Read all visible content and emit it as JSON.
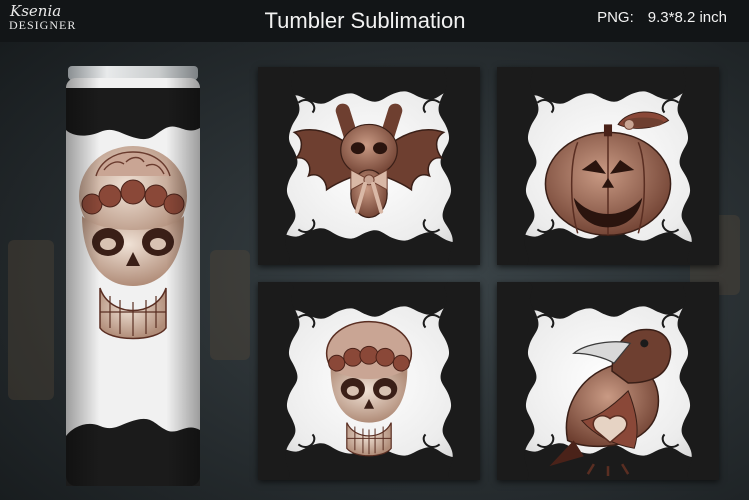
{
  "brand": {
    "script_text": "Ksenia",
    "caps_text": "DESIGNER"
  },
  "header": {
    "title": "Tumbler Sublimation",
    "format_label": "PNG:",
    "format_size": "9.3*8.2 inch"
  },
  "palette": {
    "lace": "#1a1a1a",
    "paper": "#f2f2f2",
    "rose_brown": "#8a5a4a",
    "bone": "#e6d3c4"
  },
  "designs": [
    "bat",
    "pumpkin",
    "skull",
    "raven"
  ]
}
